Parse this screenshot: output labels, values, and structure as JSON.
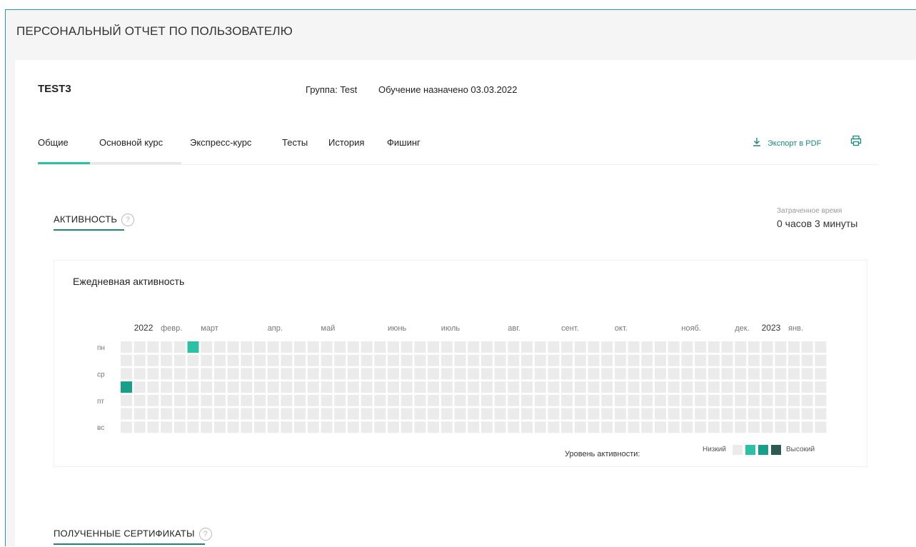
{
  "page": {
    "title": "ПЕРСОНАЛЬНЫЙ ОТЧЕТ ПО ПОЛЬЗОВАТЕЛЮ"
  },
  "user": {
    "name": "TEST3",
    "group": "Группа: Test",
    "assigned": "Обучение назначено 03.03.2022"
  },
  "tabs": [
    {
      "label": "Общие",
      "active": true
    },
    {
      "label": "Основной курс"
    },
    {
      "label": "Экспресс-курс"
    },
    {
      "label": "Тесты"
    },
    {
      "label": "История"
    },
    {
      "label": "Фишинг"
    }
  ],
  "toolbar": {
    "export_label": "Экспорт в PDF"
  },
  "activity": {
    "section_title": "АКТИВНОСТЬ",
    "help": "?",
    "time_label": "Затраченное время",
    "time_value": "0 часов 3 минуты",
    "chart_title": "Ежедневная активность",
    "legend_prefix": "Уровень активности:",
    "legend_low": "Низкий",
    "legend_high": "Высокий"
  },
  "certificates": {
    "section_title": "ПОЛУЧЕННЫЕ СЕРТИФИКАТЫ",
    "help": "?"
  },
  "colors": {
    "accent": "#2cc0a4",
    "accent_dark": "#1a8a78",
    "cell_empty": "#ebebeb",
    "level_1": "#2cc0a4",
    "level_2": "#16a08a",
    "level_3": "#2d5a52"
  },
  "chart_data": {
    "type": "heatmap",
    "title": "Ежедневная активность",
    "weeks": 53,
    "days": 7,
    "year_labels": [
      {
        "label": "2022",
        "week": 1
      },
      {
        "label": "2023",
        "week": 48
      }
    ],
    "month_labels": [
      {
        "label": "февр.",
        "week": 3
      },
      {
        "label": "март",
        "week": 6
      },
      {
        "label": "апр.",
        "week": 11
      },
      {
        "label": "май",
        "week": 15
      },
      {
        "label": "июнь",
        "week": 20
      },
      {
        "label": "июль",
        "week": 24
      },
      {
        "label": "авг.",
        "week": 29
      },
      {
        "label": "сент.",
        "week": 33
      },
      {
        "label": "окт.",
        "week": 37
      },
      {
        "label": "нояб.",
        "week": 42
      },
      {
        "label": "дек.",
        "week": 46
      },
      {
        "label": "янв.",
        "week": 50
      }
    ],
    "day_labels": [
      {
        "label": "пн",
        "row": 0
      },
      {
        "label": "ср",
        "row": 2
      },
      {
        "label": "пт",
        "row": 4
      },
      {
        "label": "вс",
        "row": 6
      }
    ],
    "active_cells": [
      {
        "week": 0,
        "day": 3,
        "level": 2
      },
      {
        "week": 5,
        "day": 0,
        "level": 1
      }
    ]
  }
}
